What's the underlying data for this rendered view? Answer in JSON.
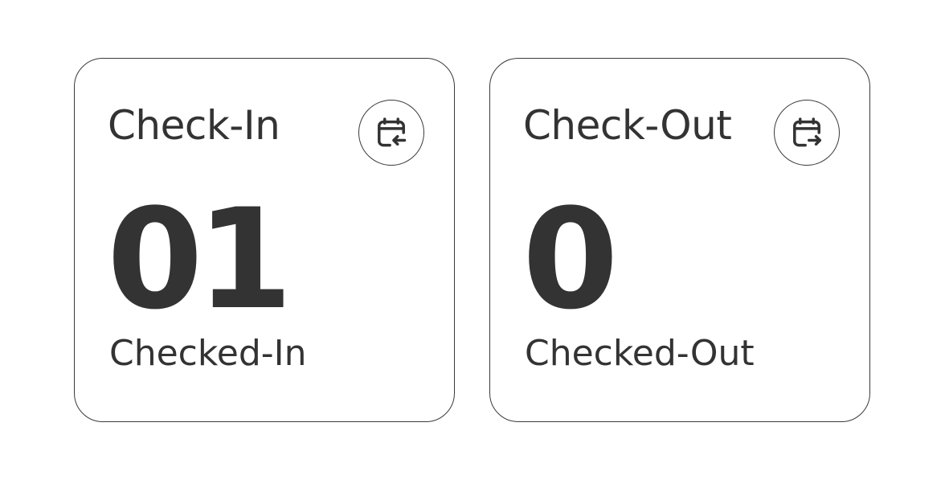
{
  "cards": [
    {
      "title": "Check-In",
      "count": "01",
      "subtitle": "Checked-In",
      "icon": "calendar-checkin-icon"
    },
    {
      "title": "Check-Out",
      "count": "0",
      "subtitle": "Checked-Out",
      "icon": "calendar-checkout-icon"
    }
  ],
  "colors": {
    "text": "#333333",
    "border": "#3a3a3a",
    "background": "#ffffff"
  }
}
